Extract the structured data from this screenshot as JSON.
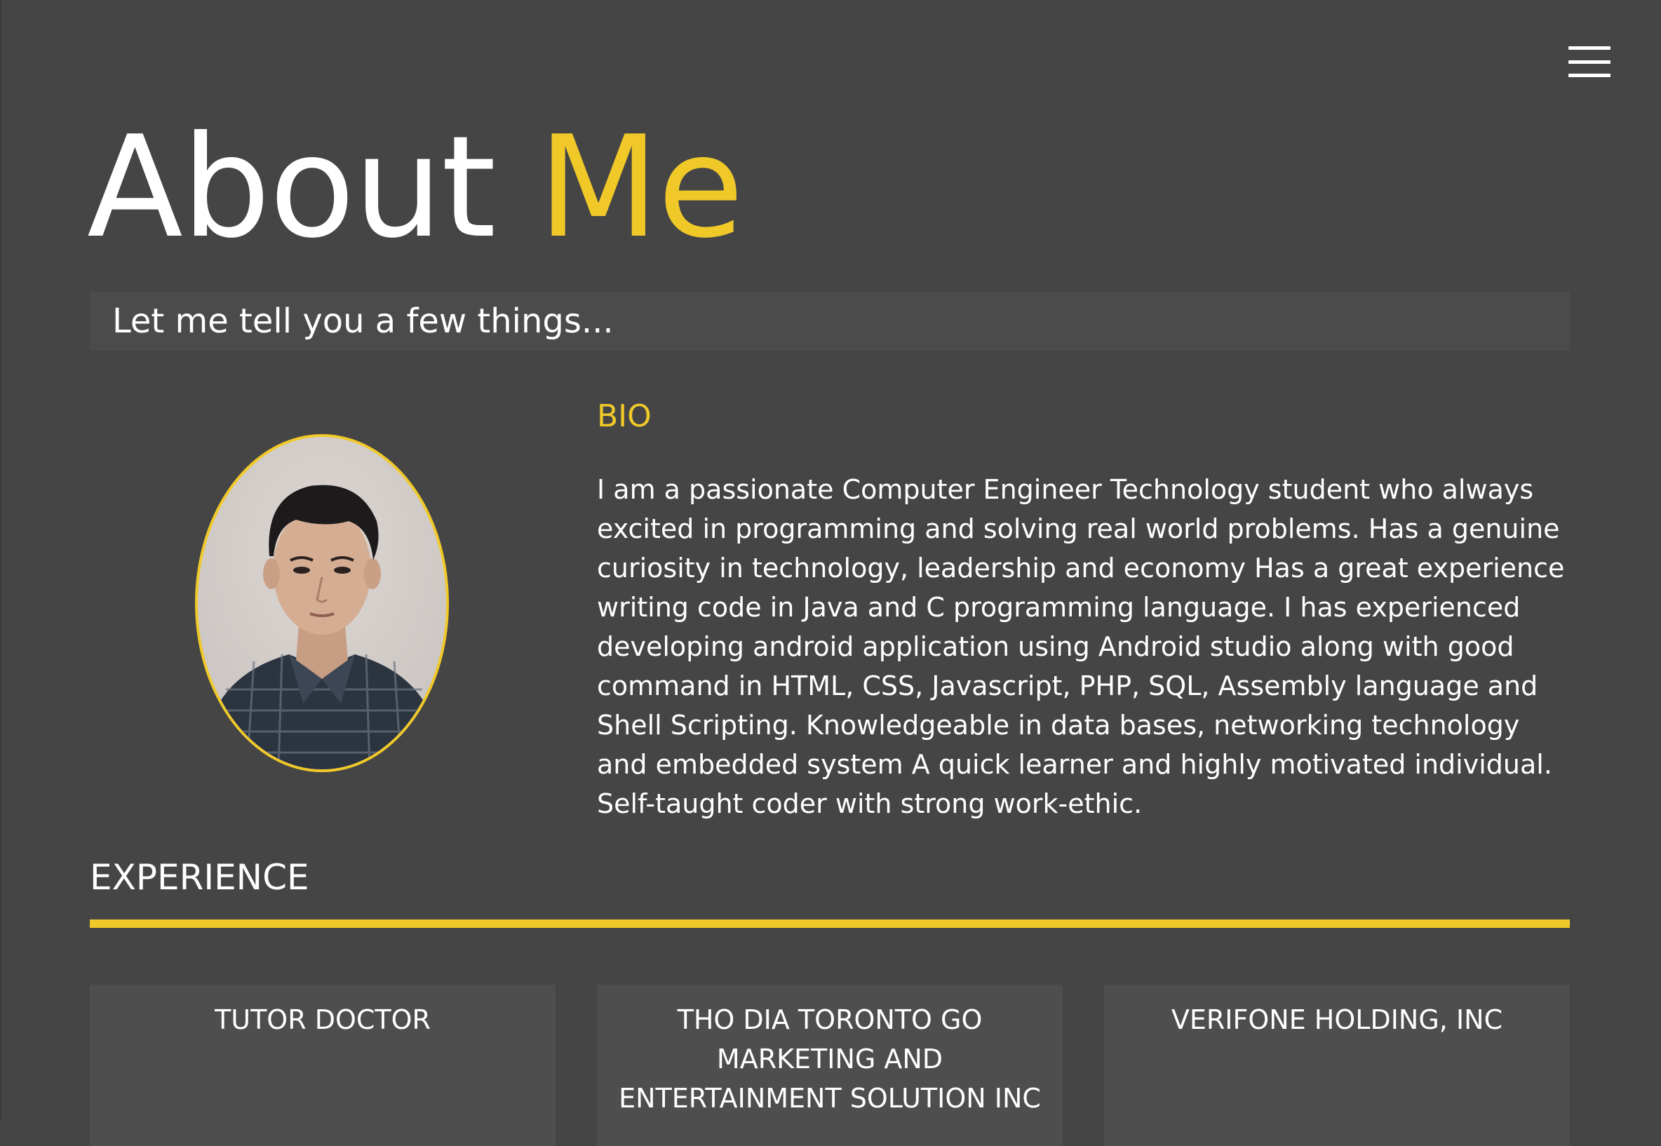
{
  "header": {
    "title_main": "About",
    "title_accent": "Me",
    "menu_icon": "hamburger-menu-icon"
  },
  "intro": {
    "text": "Let me tell you a few things..."
  },
  "bio": {
    "heading": "BIO",
    "text": "I am a passionate Computer Engineer Technology student who always excited in programming and solving real world problems. Has a genuine curiosity in technology, leadership and economy Has a great experience writing code in Java and C programming language. I has experienced developing android application using Android studio along with good command in HTML, CSS, Javascript, PHP, SQL, Assembly language and Shell Scripting. Knowledgeable in data bases, networking technology and embedded system A quick learner and highly motivated individual. Self-taught coder with strong work-ethic."
  },
  "experience": {
    "heading": "EXPERIENCE",
    "cards": [
      {
        "company": "TUTOR DOCTOR",
        "role": ""
      },
      {
        "company": "THO DIA TORONTO GO MARKETING AND ENTERTAINMENT SOLUTION INC",
        "role": ""
      },
      {
        "company": "VERIFONE HOLDING, INC",
        "role": ""
      }
    ]
  },
  "colors": {
    "background": "#454545",
    "accent": "#f0c929",
    "text": "#ffffff",
    "panel": "#4b4b4b"
  }
}
